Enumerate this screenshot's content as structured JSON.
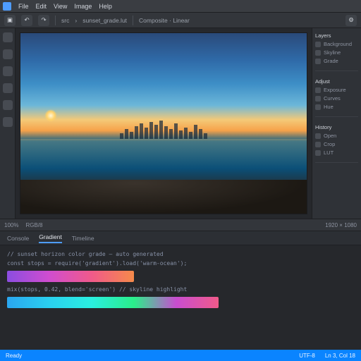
{
  "menu": {
    "items": [
      "File",
      "Edit",
      "View",
      "Image",
      "Help"
    ]
  },
  "toolbar": {
    "crumb1": "src",
    "crumb2": "sunset_grade.lut",
    "info": "Composite · Linear"
  },
  "leftrail": {
    "count": 6
  },
  "rightpanel": {
    "groups": [
      {
        "title": "Layers",
        "items": [
          "Background",
          "Skyline",
          "Grade"
        ]
      },
      {
        "title": "Adjust",
        "items": [
          "Exposure",
          "Curves",
          "Hue"
        ]
      },
      {
        "title": "History",
        "items": [
          "Open",
          "Crop",
          "LUT"
        ]
      }
    ]
  },
  "status": {
    "left": "100%",
    "mid": "RGB/8",
    "right": "1920 × 1080"
  },
  "btabs": {
    "items": [
      "Console",
      "Gradient",
      "Timeline"
    ],
    "active": 1
  },
  "editor": {
    "lines": [
      "// sunset horizon color grade — auto generated",
      "const stops = require('gradient').load('warm-ocean');",
      "mix(stops, 0.42, blend='screen')  // skyline highlight"
    ],
    "noteA": "stops: warm → magenta → coral",
    "noteB": "stops: cyan → teal → mint → magenta → coral"
  },
  "footer": {
    "left": "Ready",
    "mid": "UTF-8",
    "right": "Ln 3, Col 18"
  },
  "skyline_heights": [
    8,
    14,
    10,
    18,
    22,
    16,
    24,
    20,
    26,
    18,
    14,
    22,
    12,
    16,
    10,
    20,
    14,
    8
  ]
}
